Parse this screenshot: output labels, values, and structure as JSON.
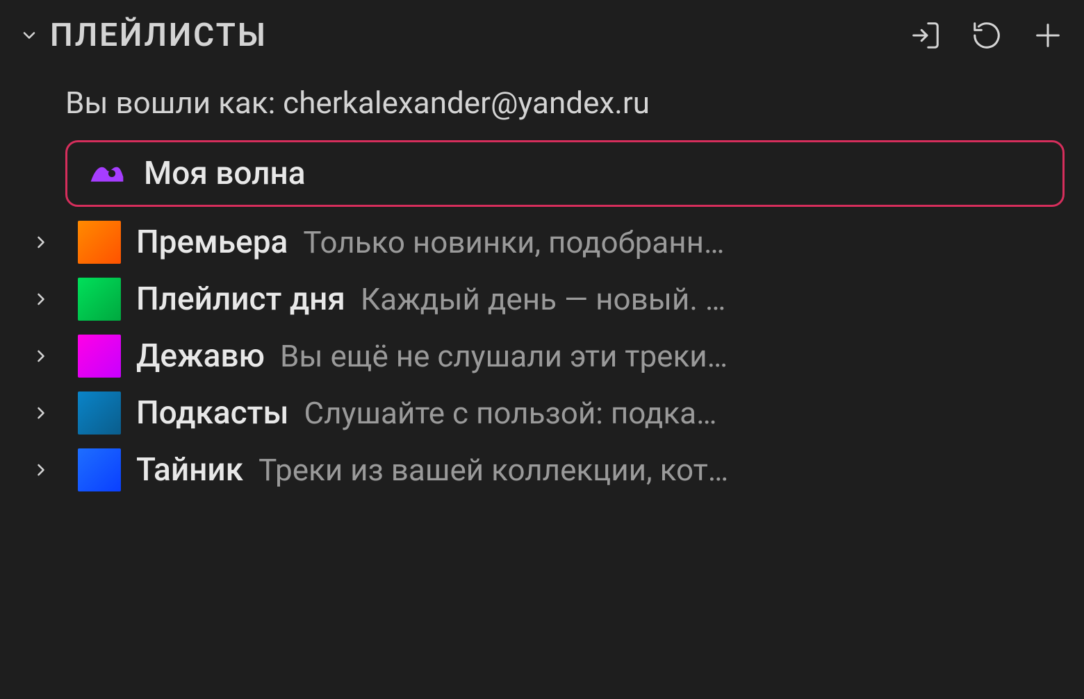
{
  "header": {
    "title": "ПЛЕЙЛИСТЫ"
  },
  "loginText": "Вы вошли как: cherkalexander@yandex.ru",
  "highlighted": {
    "label": "Моя волна"
  },
  "items": [
    {
      "label": "Премьера",
      "desc": "Только новинки, подобранн…",
      "thumb": "thumb-orange"
    },
    {
      "label": "Плейлист дня",
      "desc": "Каждый день — новый. …",
      "thumb": "thumb-green"
    },
    {
      "label": "Дежавю",
      "desc": "Вы ещё не слушали эти треки…",
      "thumb": "thumb-magenta"
    },
    {
      "label": "Подкасты",
      "desc": "Слушайте с пользой: подка…",
      "thumb": "thumb-teal"
    },
    {
      "label": "Тайник",
      "desc": "Треки из вашей коллекции, кот…",
      "thumb": "thumb-blue"
    }
  ]
}
